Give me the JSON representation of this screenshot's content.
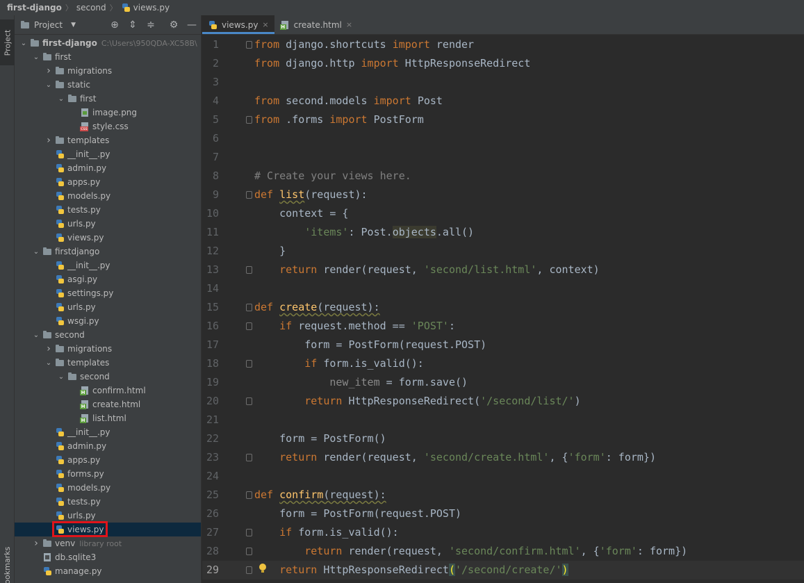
{
  "breadcrumb": {
    "project": "first-django",
    "folder": "second",
    "file": "views.py"
  },
  "left_strip": {
    "project_tab": "Project",
    "bookmarks_tab": "Bookmarks"
  },
  "project_panel": {
    "title": "Project",
    "tree": [
      {
        "label": "first-django",
        "extra": "C:\\Users\\950QDA-XC58B\\",
        "icon": "folder-icon",
        "arrow": "down",
        "level": 0,
        "bold": true
      },
      {
        "label": "first",
        "icon": "folder-icon",
        "arrow": "down",
        "level": 1
      },
      {
        "label": "migrations",
        "icon": "folder-icon",
        "arrow": "right",
        "level": 2
      },
      {
        "label": "static",
        "icon": "folder-icon",
        "arrow": "down",
        "level": 2
      },
      {
        "label": "first",
        "icon": "folder-icon",
        "arrow": "down",
        "level": 3
      },
      {
        "label": "image.png",
        "icon": "image-file-icon",
        "level": 4
      },
      {
        "label": "style.css",
        "icon": "css-file-icon",
        "level": 4
      },
      {
        "label": "templates",
        "icon": "folder-icon",
        "arrow": "right",
        "level": 2
      },
      {
        "label": "__init__.py",
        "icon": "python-file-icon",
        "level": 2
      },
      {
        "label": "admin.py",
        "icon": "python-file-icon",
        "level": 2
      },
      {
        "label": "apps.py",
        "icon": "python-file-icon",
        "level": 2
      },
      {
        "label": "models.py",
        "icon": "python-file-icon",
        "level": 2
      },
      {
        "label": "tests.py",
        "icon": "python-file-icon",
        "level": 2
      },
      {
        "label": "urls.py",
        "icon": "python-file-icon",
        "level": 2
      },
      {
        "label": "views.py",
        "icon": "python-file-icon",
        "level": 2
      },
      {
        "label": "firstdjango",
        "icon": "folder-icon",
        "arrow": "down",
        "level": 1
      },
      {
        "label": "__init__.py",
        "icon": "python-file-icon",
        "level": 2
      },
      {
        "label": "asgi.py",
        "icon": "python-file-icon",
        "level": 2
      },
      {
        "label": "settings.py",
        "icon": "python-file-icon",
        "level": 2
      },
      {
        "label": "urls.py",
        "icon": "python-file-icon",
        "level": 2
      },
      {
        "label": "wsgi.py",
        "icon": "python-file-icon",
        "level": 2
      },
      {
        "label": "second",
        "icon": "folder-icon",
        "arrow": "down",
        "level": 1
      },
      {
        "label": "migrations",
        "icon": "folder-icon",
        "arrow": "right",
        "level": 2
      },
      {
        "label": "templates",
        "icon": "folder-icon",
        "arrow": "down",
        "level": 2
      },
      {
        "label": "second",
        "icon": "folder-icon",
        "arrow": "down",
        "level": 3
      },
      {
        "label": "confirm.html",
        "icon": "html-file-icon",
        "level": 4
      },
      {
        "label": "create.html",
        "icon": "html-file-icon",
        "level": 4
      },
      {
        "label": "list.html",
        "icon": "html-file-icon",
        "level": 4
      },
      {
        "label": "__init__.py",
        "icon": "python-file-icon",
        "level": 2
      },
      {
        "label": "admin.py",
        "icon": "python-file-icon",
        "level": 2
      },
      {
        "label": "apps.py",
        "icon": "python-file-icon",
        "level": 2
      },
      {
        "label": "forms.py",
        "icon": "python-file-icon",
        "level": 2
      },
      {
        "label": "models.py",
        "icon": "python-file-icon",
        "level": 2
      },
      {
        "label": "tests.py",
        "icon": "python-file-icon",
        "level": 2
      },
      {
        "label": "urls.py",
        "icon": "python-file-icon",
        "level": 2
      },
      {
        "label": "views.py",
        "icon": "python-file-icon",
        "level": 2,
        "selected": true
      },
      {
        "label": "venv",
        "extra": "library root",
        "icon": "folder-icon",
        "arrow": "right",
        "level": 1
      },
      {
        "label": "db.sqlite3",
        "icon": "database-file-icon",
        "level": 1
      },
      {
        "label": "manage.py",
        "icon": "python-file-icon",
        "level": 1
      }
    ]
  },
  "editor": {
    "tabs": [
      {
        "label": "views.py",
        "icon": "python-file-icon",
        "active": true
      },
      {
        "label": "create.html",
        "icon": "html-file-icon",
        "active": false
      }
    ],
    "close_glyph": "×",
    "current_line": 29,
    "lines": [
      {
        "n": "1",
        "fold": true,
        "t": [
          [
            "kw",
            "from "
          ],
          [
            "",
            "django.shortcuts "
          ],
          [
            "kw",
            "import "
          ],
          [
            "",
            "render"
          ]
        ]
      },
      {
        "n": "2",
        "t": [
          [
            "kw",
            "from "
          ],
          [
            "",
            "django.http "
          ],
          [
            "kw",
            "import "
          ],
          [
            "",
            "HttpResponseRedirect"
          ]
        ]
      },
      {
        "n": "3",
        "t": []
      },
      {
        "n": "4",
        "t": [
          [
            "kw",
            "from "
          ],
          [
            "",
            "second.models "
          ],
          [
            "kw",
            "import "
          ],
          [
            "",
            "Post"
          ]
        ]
      },
      {
        "n": "5",
        "fold": true,
        "t": [
          [
            "kw",
            "from "
          ],
          [
            "",
            ".forms "
          ],
          [
            "kw",
            "import "
          ],
          [
            "",
            "PostForm"
          ]
        ]
      },
      {
        "n": "6",
        "t": []
      },
      {
        "n": "7",
        "t": []
      },
      {
        "n": "8",
        "t": [
          [
            "cm",
            "# Create your views here."
          ]
        ]
      },
      {
        "n": "9",
        "fold": true,
        "t": [
          [
            "kw",
            "def "
          ],
          [
            "fn wavy",
            "list"
          ],
          [
            "",
            "(request):"
          ]
        ]
      },
      {
        "n": "10",
        "t": [
          [
            "",
            "    context = {"
          ]
        ]
      },
      {
        "n": "11",
        "t": [
          [
            "",
            "        "
          ],
          [
            "str",
            "'items'"
          ],
          [
            "",
            ": Post."
          ],
          [
            "hl",
            "objects"
          ],
          [
            "",
            ".all()"
          ]
        ]
      },
      {
        "n": "12",
        "t": [
          [
            "",
            "    }"
          ]
        ]
      },
      {
        "n": "13",
        "fold": true,
        "t": [
          [
            "",
            "    "
          ],
          [
            "kw",
            "return "
          ],
          [
            "",
            "render(request, "
          ],
          [
            "str",
            "'second/list.html'"
          ],
          [
            "",
            ", context)"
          ]
        ]
      },
      {
        "n": "14",
        "t": []
      },
      {
        "n": "15",
        "fold": true,
        "t": [
          [
            "kw",
            "def "
          ],
          [
            "fn wavy",
            "create"
          ],
          [
            "wavy",
            "(request):"
          ]
        ]
      },
      {
        "n": "16",
        "fold": true,
        "t": [
          [
            "",
            "    "
          ],
          [
            "kw",
            "if "
          ],
          [
            "",
            "request.method == "
          ],
          [
            "str",
            "'POST'"
          ],
          [
            "",
            ":"
          ]
        ]
      },
      {
        "n": "17",
        "t": [
          [
            "",
            "        form = PostForm(request.POST)"
          ]
        ]
      },
      {
        "n": "18",
        "fold": true,
        "t": [
          [
            "",
            "        "
          ],
          [
            "kw",
            "if "
          ],
          [
            "",
            "form.is_valid():"
          ]
        ]
      },
      {
        "n": "19",
        "t": [
          [
            "",
            "            "
          ],
          [
            "dim",
            "new_item"
          ],
          [
            "",
            " = form.save()"
          ]
        ]
      },
      {
        "n": "20",
        "fold": true,
        "t": [
          [
            "",
            "        "
          ],
          [
            "kw",
            "return "
          ],
          [
            "",
            "HttpResponseRedirect("
          ],
          [
            "str",
            "'/second/list/'"
          ],
          [
            "",
            ")"
          ]
        ]
      },
      {
        "n": "21",
        "t": []
      },
      {
        "n": "22",
        "t": [
          [
            "",
            "    form = PostForm()"
          ]
        ]
      },
      {
        "n": "23",
        "fold": true,
        "t": [
          [
            "",
            "    "
          ],
          [
            "kw",
            "return "
          ],
          [
            "",
            "render(request, "
          ],
          [
            "str",
            "'second/create.html'"
          ],
          [
            "",
            ", {"
          ],
          [
            "str",
            "'form'"
          ],
          [
            "",
            ": form})"
          ]
        ]
      },
      {
        "n": "24",
        "t": []
      },
      {
        "n": "25",
        "fold": true,
        "t": [
          [
            "kw",
            "def "
          ],
          [
            "fn wavy",
            "confirm"
          ],
          [
            "wavy",
            "(request):"
          ]
        ]
      },
      {
        "n": "26",
        "t": [
          [
            "",
            "    form = PostForm(request.POST)"
          ]
        ]
      },
      {
        "n": "27",
        "fold": true,
        "t": [
          [
            "",
            "    "
          ],
          [
            "kw",
            "if "
          ],
          [
            "",
            "form.is_valid():"
          ]
        ]
      },
      {
        "n": "28",
        "fold": true,
        "t": [
          [
            "",
            "        "
          ],
          [
            "kw",
            "return "
          ],
          [
            "",
            "render(request, "
          ],
          [
            "str",
            "'second/confirm.html'"
          ],
          [
            "",
            ", {"
          ],
          [
            "str",
            "'form'"
          ],
          [
            "",
            ": form})"
          ]
        ]
      },
      {
        "n": "29",
        "fold": true,
        "bulb": true,
        "t": [
          [
            "",
            "    "
          ],
          [
            "kw",
            "return "
          ],
          [
            "",
            "HttpResponseRedirect"
          ],
          [
            "brace",
            "("
          ],
          [
            "str",
            "'/second/create/'"
          ],
          [
            "brace",
            ")"
          ]
        ]
      }
    ]
  }
}
